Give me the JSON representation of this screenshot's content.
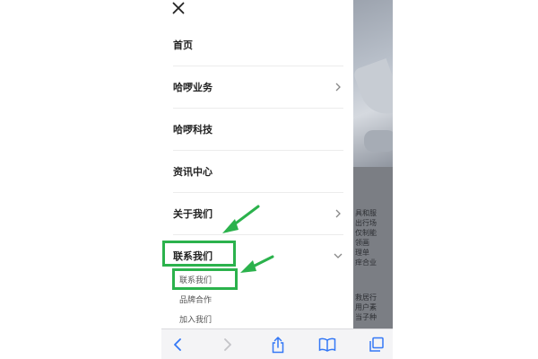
{
  "menu": {
    "items": [
      {
        "label": "首页",
        "has_chevron": false
      },
      {
        "label": "哈啰业务",
        "has_chevron": true,
        "chevron": "chevron-right-icon"
      },
      {
        "label": "哈啰科技",
        "has_chevron": false
      },
      {
        "label": "资讯中心",
        "has_chevron": false
      },
      {
        "label": "关于我们",
        "has_chevron": true,
        "chevron": "chevron-right-icon"
      },
      {
        "label": "联系我们",
        "has_chevron": true,
        "chevron": "chevron-down-icon",
        "expanded": true
      }
    ],
    "sub_items": [
      {
        "label": "联系我们"
      },
      {
        "label": "品牌合作"
      },
      {
        "label": "加入我们"
      }
    ]
  },
  "background_text": {
    "block1": [
      "具和服",
      "出行场",
      "仅制能",
      "领画",
      "理单",
      "痒合业"
    ],
    "block2": [
      "救居行",
      "用户素",
      "当子种"
    ]
  },
  "toolbar": {
    "icons": [
      "back-icon",
      "forward-icon",
      "share-icon",
      "bookmarks-icon",
      "tabs-icon"
    ]
  },
  "colors": {
    "highlight": "#2bb24c",
    "arrow": "#2bb24c",
    "ios_blue": "#3478f6",
    "disabled": "#c4c4c8"
  }
}
